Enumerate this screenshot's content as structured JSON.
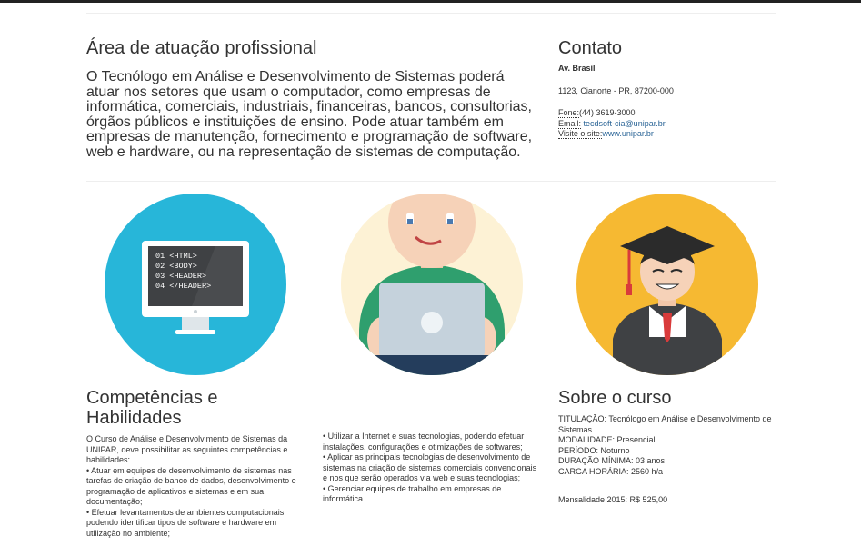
{
  "area": {
    "title": "Área de atuação profissional",
    "text": "O Tecnólogo em Análise e Desenvolvimento de Sistemas poderá atuar nos setores que usam o computador, como empresas de informática, comerciais, industriais, financeiras, bancos, consultorias, órgãos públicos e instituições de ensino. Pode atuar também em empresas de manutenção, fornecimento e programação de software, web e hardware, ou na representação de sistemas de computação."
  },
  "contact": {
    "title": "Contato",
    "street": "Av. Brasil",
    "address": "1123, Cianorte - PR, 87200-000",
    "phone_label": "Fone:",
    "phone": "(44) 3619-3000",
    "email_label": "Email:",
    "email": "tecdsoft-cia@unipar.br",
    "site_label": "Visite o site:",
    "site": "www.unipar.br"
  },
  "illustrations": {
    "code_lines": [
      "01 <HTML>",
      "02 <BODY>",
      "03 <HEADER>",
      "04 </HEADER>"
    ],
    "colors": {
      "blue": "#27b6d9",
      "cream": "#fdf2d5",
      "yellow": "#f6b932"
    }
  },
  "competencias": {
    "title": "Competências e Habilidades",
    "col1": [
      "O Curso de Análise e Desenvolvimento de Sistemas da UNIPAR, deve possibilitar as seguintes competências e habilidades:",
      "• Atuar em equipes de desenvolvimento de sistemas nas tarefas de criação de banco de dados, desenvolvimento e programação de aplicativos e sistemas e em sua documentação;",
      "• Efetuar levantamentos de ambientes computacionais podendo identificar tipos de software e hardware em utilização no ambiente;"
    ],
    "col2": [
      "• Utilizar a Internet e suas tecnologias, podendo efetuar instalações, configurações e otimizações de softwares;",
      "• Aplicar as principais tecnologias de desenvolvimento de sistemas na criação de sistemas comerciais convencionais e nos que serão operados via web e suas tecnologias;",
      "• Gerenciar equipes de trabalho em empresas de informática."
    ]
  },
  "sobre": {
    "title": "Sobre o curso",
    "titulacao_label": "TITULAÇÃO:",
    "titulacao": "Tecnólogo em Análise e Desenvolvimento de Sistemas",
    "modalidade_label": "MODALIDADE:",
    "modalidade": "Presencial",
    "periodo_label": "PERÍODO:",
    "periodo": "Noturno",
    "duracao_label": "DURAÇÃO MÍNIMA:",
    "duracao": "03 anos",
    "carga_label": "CARGA HORÁRIA:",
    "carga": "2560 h/a",
    "mensalidade": "Mensalidade 2015: R$ 525,00"
  }
}
